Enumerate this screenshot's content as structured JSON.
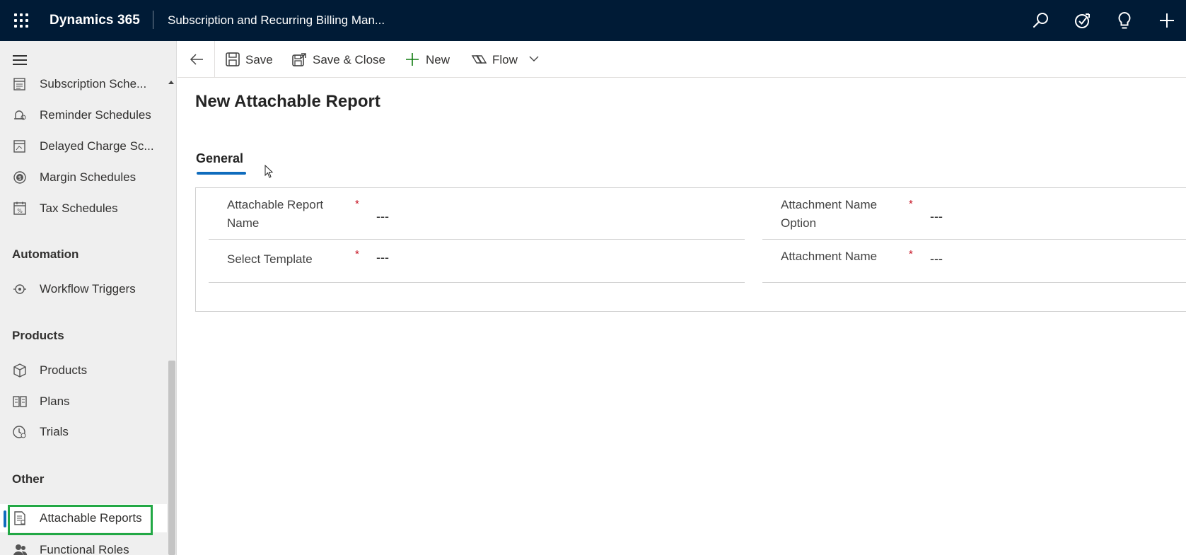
{
  "header": {
    "brand": "Dynamics 365",
    "app_name": "Subscription and Recurring Billing Man..."
  },
  "sidebar": {
    "items_top": [
      {
        "label": "Subscription Sche...",
        "icon": "calendar-list-icon"
      },
      {
        "label": "Reminder Schedules",
        "icon": "bell-person-icon"
      },
      {
        "label": "Delayed Charge Sc...",
        "icon": "calendar-clock-icon"
      },
      {
        "label": "Margin Schedules",
        "icon": "dollar-circle-icon"
      },
      {
        "label": "Tax Schedules",
        "icon": "calendar-percent-icon"
      }
    ],
    "groups": {
      "automation": "Automation",
      "products": "Products",
      "other": "Other"
    },
    "automation_items": [
      {
        "label": "Workflow Triggers",
        "icon": "workflow-icon"
      }
    ],
    "products_items": [
      {
        "label": "Products",
        "icon": "box-icon"
      },
      {
        "label": "Plans",
        "icon": "plans-icon"
      },
      {
        "label": "Trials",
        "icon": "trial-icon"
      }
    ],
    "other_items": [
      {
        "label": "Attachable Reports",
        "icon": "report-icon",
        "selected": true
      },
      {
        "label": "Functional Roles",
        "icon": "people-icon"
      }
    ]
  },
  "commandbar": {
    "save": "Save",
    "save_close": "Save & Close",
    "new": "New",
    "flow": "Flow"
  },
  "form": {
    "title": "New Attachable Report",
    "tab": "General",
    "fields": {
      "report_name": {
        "label_line1": "Attachable Report",
        "label_line2": "Name",
        "required": "*",
        "value": "---"
      },
      "select_template": {
        "label": "Select Template",
        "required": "*",
        "value": "---"
      },
      "attachment_name_option": {
        "label_line1": "Attachment Name",
        "label_line2": "Option",
        "required": "*",
        "value": "---"
      },
      "attachment_name": {
        "label": "Attachment Name",
        "required": "*",
        "value": "---"
      }
    }
  },
  "colors": {
    "header_bg": "#001b36",
    "accent": "#0f6cbd",
    "highlight": "#22a845",
    "required": "#c50f1f",
    "new_icon": "#107c10"
  }
}
